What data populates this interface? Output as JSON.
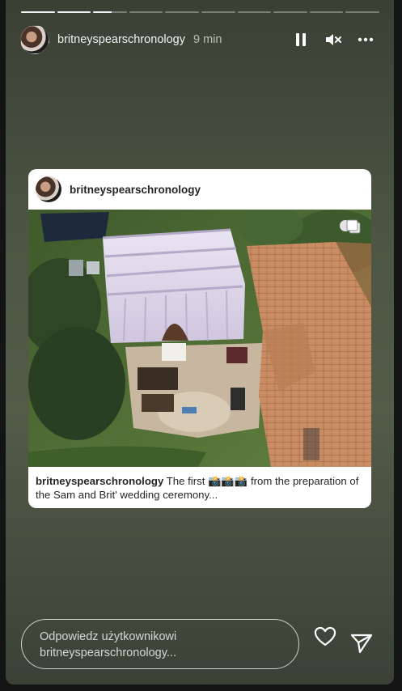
{
  "story": {
    "progress": [
      1,
      1,
      0.55,
      0,
      0,
      0,
      0,
      0,
      0,
      0
    ],
    "username": "britneyspearschronology",
    "time_ago": "9 min",
    "icons": {
      "pause": "pause-icon",
      "mute": "muted-speaker-icon",
      "more": "more-icon"
    }
  },
  "post": {
    "username": "britneyspearschronology",
    "caption_user": "britneyspearschronology",
    "caption_text": " The first 📸📸📸 from the preparation of the Sam and Brit' wedding ceremony...",
    "multi_image_icon": "carousel-icon"
  },
  "reply": {
    "placeholder": "Odpowiedz użytkownikowi britneyspearschronology..."
  },
  "actions": {
    "like": "heart-icon",
    "send": "send-icon"
  }
}
